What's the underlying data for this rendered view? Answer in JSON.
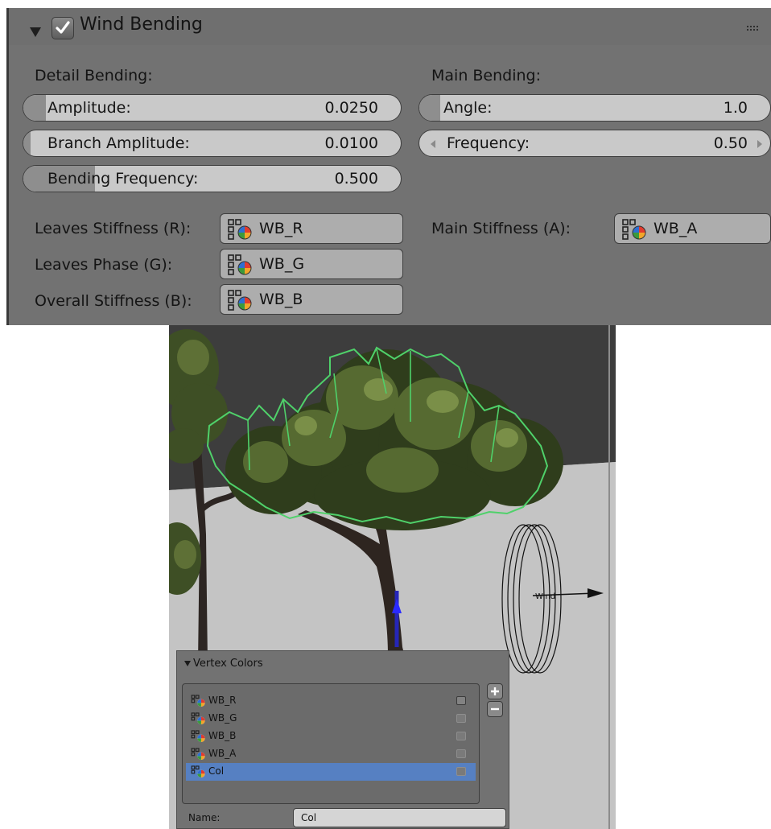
{
  "panel": {
    "title": "Wind Bending",
    "enabled": true,
    "detail": {
      "heading": "Detail Bending:",
      "sliders": [
        {
          "label": "Amplitude:",
          "value": "0.0250",
          "fill": 0.06
        },
        {
          "label": "Branch Amplitude:",
          "value": "0.0100",
          "fill": 0.02
        },
        {
          "label": "Bending Frequency:",
          "value": "0.500",
          "fill": 0.19
        }
      ]
    },
    "main": {
      "heading": "Main Bending:",
      "sliders": [
        {
          "label": "Angle:",
          "value": "1.0",
          "fill": 0.06
        },
        {
          "label": "Frequency:",
          "value": "0.50"
        }
      ]
    },
    "stiffness": [
      {
        "label": "Leaves Stiffness (R):",
        "value": "WB_R"
      },
      {
        "label": "Leaves Phase (G):",
        "value": "WB_G"
      },
      {
        "label": "Overall Stiffness (B):",
        "value": "WB_B"
      }
    ],
    "main_stiffness": {
      "label": "Main Stiffness (A):",
      "value": "WB_A"
    }
  },
  "viewport": {
    "wind_label": "Wind"
  },
  "vertex_colors": {
    "title": "Vertex Colors",
    "layers": [
      "WB_R",
      "WB_G",
      "WB_B",
      "WB_A",
      "Col"
    ],
    "selected": "Col",
    "name_label": "Name:",
    "name_value": "Col"
  }
}
